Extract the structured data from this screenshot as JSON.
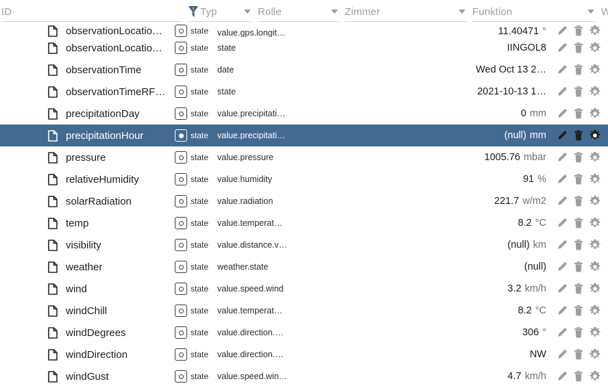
{
  "header": {
    "columns": [
      {
        "key": "id",
        "label": "ID",
        "has_caret": false,
        "has_filter_icon": false
      },
      {
        "key": "typ",
        "label": "Typ",
        "has_caret": true,
        "has_filter_icon": true
      },
      {
        "key": "rolle",
        "label": "Rolle",
        "has_caret": true,
        "has_filter_icon": false
      },
      {
        "key": "zimmer",
        "label": "Zimmer",
        "has_caret": true,
        "has_filter_icon": false
      },
      {
        "key": "funktion",
        "label": "Funktion",
        "has_caret": true,
        "has_filter_icon": false
      },
      {
        "key": "wert",
        "label": "We",
        "has_caret": false,
        "has_filter_icon": false
      }
    ]
  },
  "colors": {
    "selection_blue": "#436a90",
    "filter_placeholder": "#9e9e9e",
    "action_icon_gray": "#9d9d9d",
    "unit_gray": "#6d6d6d",
    "funnel_blue": "#2f5d8f",
    "funnel_orange": "#e08a20"
  },
  "icons": {
    "filter": "funnel-icon",
    "caret": "chevron-down-icon",
    "row": "document-icon",
    "type": "state-radio-icon",
    "edit": "pencil-icon",
    "delete": "trash-icon",
    "settings": "gear-icon"
  },
  "rows": [
    {
      "id": "observationLocatio…",
      "typ": "state",
      "rolle": "value.gps.longit…",
      "zimmer": "",
      "funktion": "",
      "wert": "11.40471",
      "unit": "°",
      "selected": false,
      "clipped": true
    },
    {
      "id": "observationLocatio…",
      "typ": "state",
      "rolle": "state",
      "zimmer": "",
      "funktion": "",
      "wert": "IINGOL8",
      "unit": "",
      "selected": false,
      "clipped": false
    },
    {
      "id": "observationTime",
      "typ": "state",
      "rolle": "date",
      "zimmer": "",
      "funktion": "",
      "wert": "Wed Oct 13 2…",
      "unit": "",
      "selected": false,
      "clipped": false
    },
    {
      "id": "observationTimeRF…",
      "typ": "state",
      "rolle": "state",
      "zimmer": "",
      "funktion": "",
      "wert": "2021-10-13 1…",
      "unit": "",
      "selected": false,
      "clipped": false
    },
    {
      "id": "precipitationDay",
      "typ": "state",
      "rolle": "value.precipitati…",
      "zimmer": "",
      "funktion": "",
      "wert": "0",
      "unit": "mm",
      "selected": false,
      "clipped": false
    },
    {
      "id": "precipitationHour",
      "typ": "state",
      "rolle": "value.precipitati…",
      "zimmer": "",
      "funktion": "",
      "wert": "(null)",
      "unit": "mm",
      "selected": true,
      "clipped": false
    },
    {
      "id": "pressure",
      "typ": "state",
      "rolle": "value.pressure",
      "zimmer": "",
      "funktion": "",
      "wert": "1005.76",
      "unit": "mbar",
      "selected": false,
      "clipped": false
    },
    {
      "id": "relativeHumidity",
      "typ": "state",
      "rolle": "value.humidity",
      "zimmer": "",
      "funktion": "",
      "wert": "91",
      "unit": "%",
      "selected": false,
      "clipped": false
    },
    {
      "id": "solarRadiation",
      "typ": "state",
      "rolle": "value.radiation",
      "zimmer": "",
      "funktion": "",
      "wert": "221.7",
      "unit": "w/m2",
      "selected": false,
      "clipped": false
    },
    {
      "id": "temp",
      "typ": "state",
      "rolle": "value.temperat…",
      "zimmer": "",
      "funktion": "",
      "wert": "8.2",
      "unit": "°C",
      "selected": false,
      "clipped": false
    },
    {
      "id": "visibility",
      "typ": "state",
      "rolle": "value.distance.v…",
      "zimmer": "",
      "funktion": "",
      "wert": "(null)",
      "unit": "km",
      "selected": false,
      "clipped": false
    },
    {
      "id": "weather",
      "typ": "state",
      "rolle": "weather.state",
      "zimmer": "",
      "funktion": "",
      "wert": "(null)",
      "unit": "",
      "selected": false,
      "clipped": false
    },
    {
      "id": "wind",
      "typ": "state",
      "rolle": "value.speed.wind",
      "zimmer": "",
      "funktion": "",
      "wert": "3.2",
      "unit": "km/h",
      "selected": false,
      "clipped": false
    },
    {
      "id": "windChill",
      "typ": "state",
      "rolle": "value.temperat…",
      "zimmer": "",
      "funktion": "",
      "wert": "8.2",
      "unit": "°C",
      "selected": false,
      "clipped": false
    },
    {
      "id": "windDegrees",
      "typ": "state",
      "rolle": "value.direction.…",
      "zimmer": "",
      "funktion": "",
      "wert": "306",
      "unit": "°",
      "selected": false,
      "clipped": false
    },
    {
      "id": "windDirection",
      "typ": "state",
      "rolle": "value.direction.…",
      "zimmer": "",
      "funktion": "",
      "wert": "NW",
      "unit": "",
      "selected": false,
      "clipped": false
    },
    {
      "id": "windGust",
      "typ": "state",
      "rolle": "value.speed.win…",
      "zimmer": "",
      "funktion": "",
      "wert": "4.7",
      "unit": "km/h",
      "selected": false,
      "clipped": false
    }
  ]
}
